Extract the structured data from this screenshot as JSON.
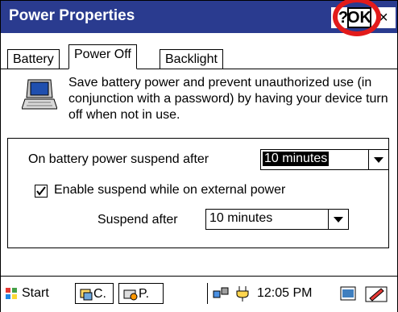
{
  "window": {
    "title": "Power Properties",
    "help_label": "?",
    "ok_label": "OK",
    "close_label": "×"
  },
  "tabs": [
    {
      "label": "Battery",
      "active": false
    },
    {
      "label": "Power Off",
      "active": true
    },
    {
      "label": "Backlight",
      "active": false
    }
  ],
  "description": "Save battery power and prevent unauthorized use (in conjunction with a password) by having your device turn off when not in use.",
  "battery_suspend": {
    "label": "On battery power suspend after",
    "value": "10 minutes"
  },
  "external_power": {
    "checkbox_label": "Enable suspend while on external power",
    "checked": true,
    "suspend_label": "Suspend after",
    "value": "10 minutes"
  },
  "taskbar": {
    "start_label": "Start",
    "task_1": "C.",
    "task_2": "P.",
    "clock": "12:05 PM"
  },
  "colors": {
    "titlebar": "#2a3b8f",
    "highlight": "#e21b1b"
  }
}
